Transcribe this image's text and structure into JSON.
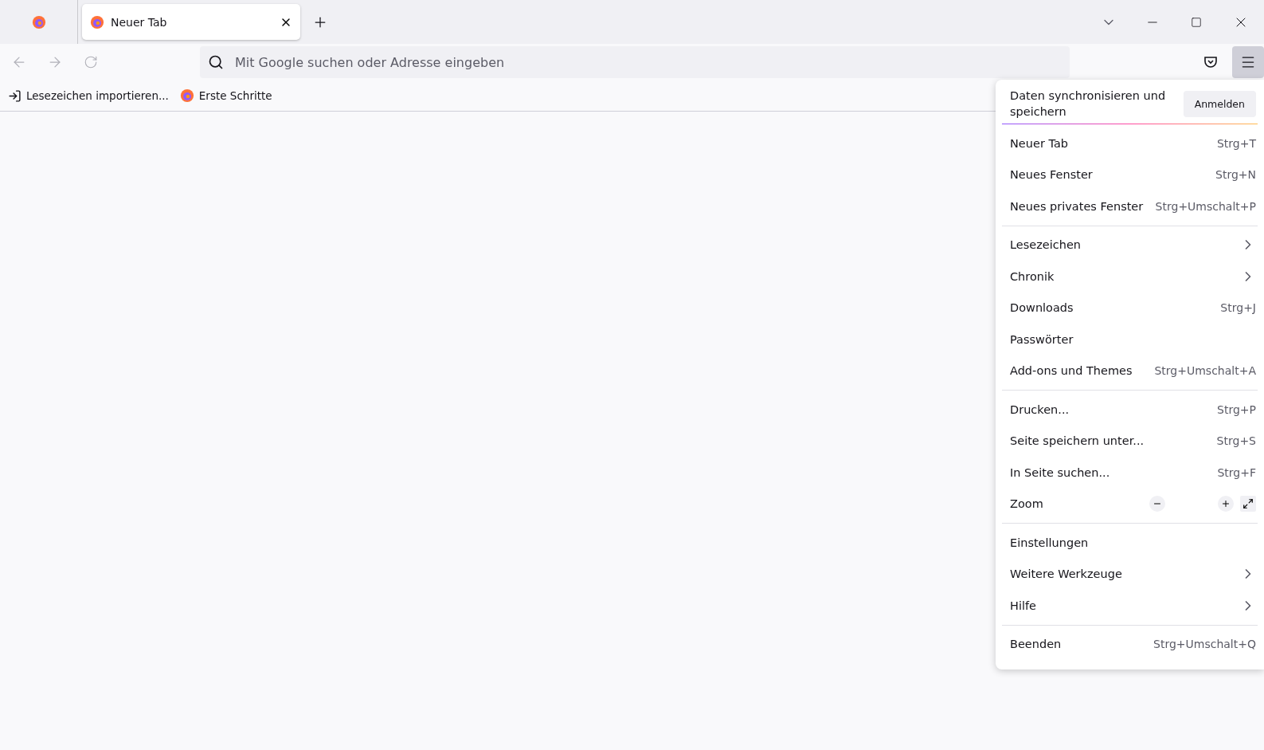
{
  "tabs": [
    {
      "kind": "pinned",
      "selected": false
    },
    {
      "kind": "normal",
      "label": "Neuer Tab",
      "selected": true
    }
  ],
  "address_bar": {
    "placeholder": "Mit Google suchen oder Adresse eingeben"
  },
  "bookmarks": [
    {
      "kind": "import",
      "label": "Lesezeichen importieren..."
    },
    {
      "kind": "site",
      "label": "Erste Schritte"
    }
  ],
  "menu_button": {
    "selected": true
  },
  "app_menu": {
    "sync": {
      "text": "Daten synchronisieren und speichern",
      "button": "Anmelden"
    },
    "sections": [
      [
        {
          "kind": "shortcut",
          "label": "Neuer Tab",
          "shortcut": "Strg+T"
        },
        {
          "kind": "shortcut",
          "label": "Neues Fenster",
          "shortcut": "Strg+N"
        },
        {
          "kind": "shortcut",
          "label": "Neues privates Fenster",
          "shortcut": "Strg+Umschalt+P"
        }
      ],
      [
        {
          "kind": "submenu",
          "label": "Lesezeichen"
        },
        {
          "kind": "submenu",
          "label": "Chronik"
        },
        {
          "kind": "shortcut",
          "label": "Downloads",
          "shortcut": "Strg+J"
        },
        {
          "kind": "plain",
          "label": "Passwörter"
        },
        {
          "kind": "shortcut",
          "label": "Add-ons und Themes",
          "shortcut": "Strg+Umschalt+A"
        }
      ],
      [
        {
          "kind": "shortcut",
          "label": "Drucken...",
          "shortcut": "Strg+P"
        },
        {
          "kind": "shortcut",
          "label": "Seite speichern unter...",
          "shortcut": "Strg+S"
        },
        {
          "kind": "shortcut",
          "label": "In Seite suchen...",
          "shortcut": "Strg+F"
        },
        {
          "kind": "zoom",
          "label": "Zoom"
        }
      ],
      [
        {
          "kind": "plain",
          "label": "Einstellungen"
        },
        {
          "kind": "submenu",
          "label": "Weitere Werkzeuge"
        },
        {
          "kind": "submenu",
          "label": "Hilfe"
        }
      ],
      [
        {
          "kind": "shortcut",
          "label": "Beenden",
          "shortcut": "Strg+Umschalt+Q"
        }
      ]
    ]
  }
}
